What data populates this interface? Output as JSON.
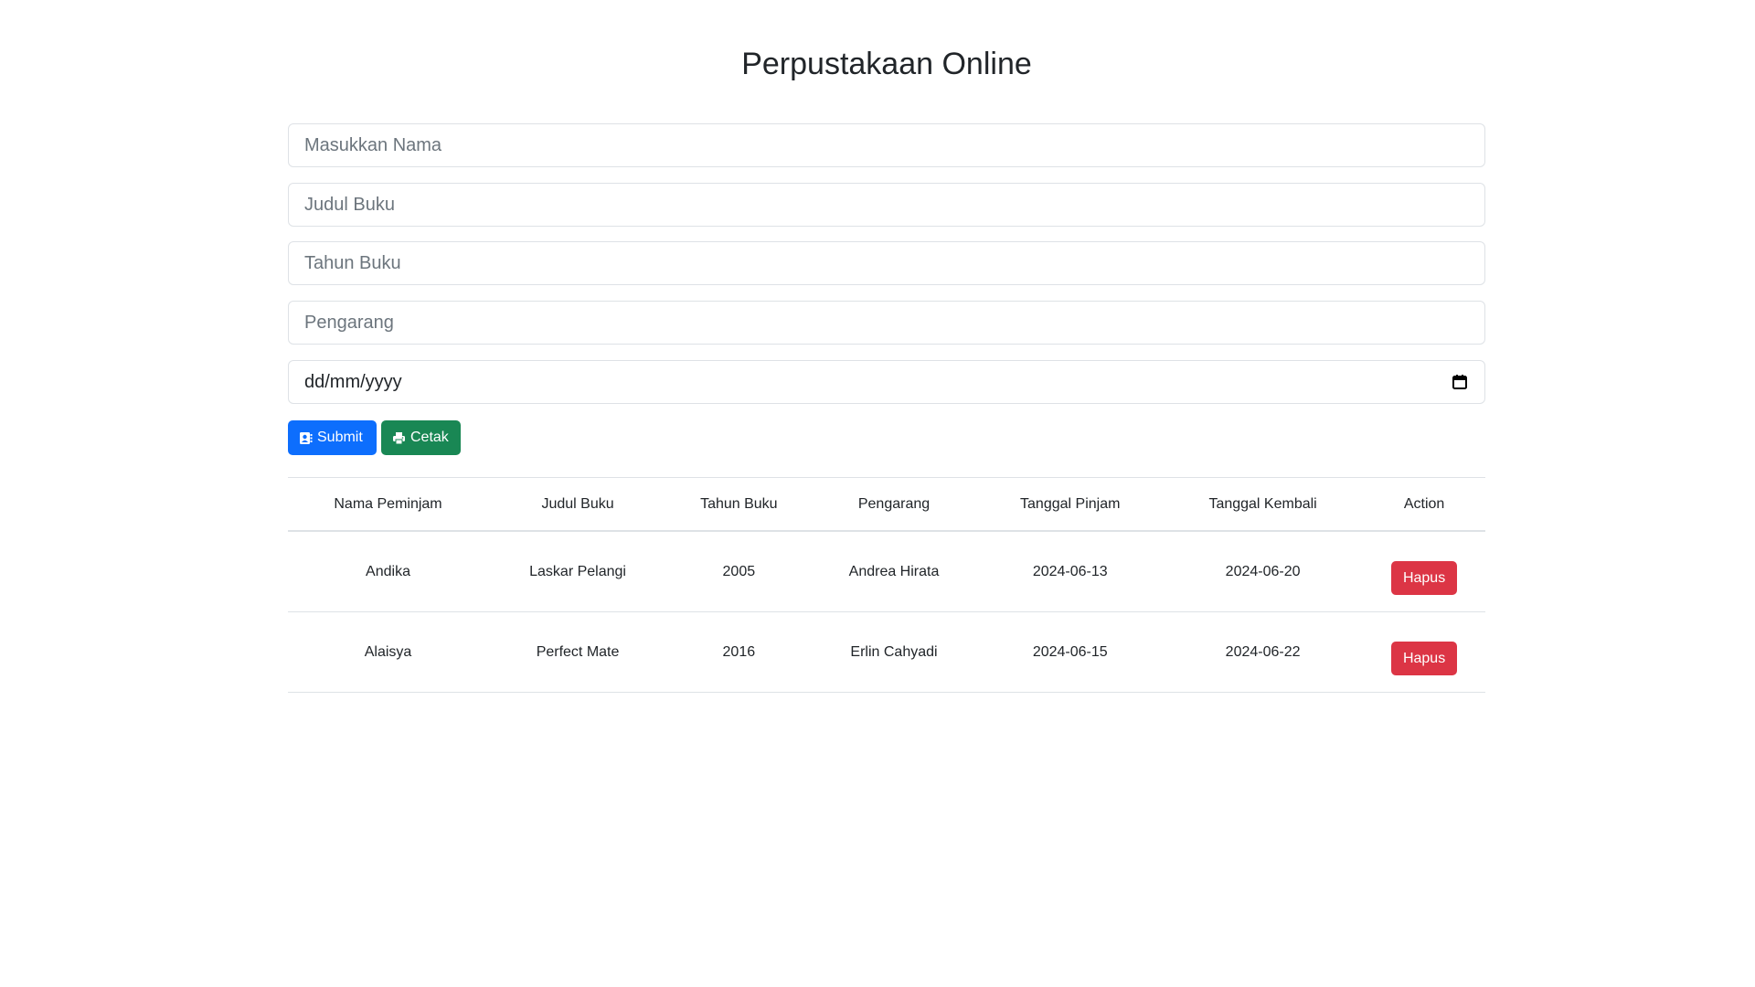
{
  "title": "Perpustakaan Online",
  "form": {
    "nama_placeholder": "Masukkan Nama",
    "judul_placeholder": "Judul Buku",
    "tahun_placeholder": "Tahun Buku",
    "pengarang_placeholder": "Pengarang",
    "date_placeholder": "dd/mm/yyyy",
    "date_icon": "calendar-icon"
  },
  "buttons": {
    "submit_label": "Submit",
    "submit_icon": "address-card-icon",
    "cetak_label": "Cetak",
    "cetak_icon": "printer-icon"
  },
  "colors": {
    "primary": "#0d6efd",
    "success": "#198754",
    "danger": "#dc3545"
  },
  "table": {
    "headers": [
      "Nama Peminjam",
      "Judul Buku",
      "Tahun Buku",
      "Pengarang",
      "Tanggal Pinjam",
      "Tanggal Kembali",
      "Action"
    ],
    "rows": [
      {
        "nama": "Andika",
        "judul": "Laskar Pelangi",
        "tahun": "2005",
        "pengarang": "Andrea Hirata",
        "tanggal_pinjam": "2024-06-13",
        "tanggal_kembali": "2024-06-20",
        "action_label": "Hapus"
      },
      {
        "nama": "Alaisya",
        "judul": "Perfect Mate",
        "tahun": "2016",
        "pengarang": "Erlin Cahyadi",
        "tanggal_pinjam": "2024-06-15",
        "tanggal_kembali": "2024-06-22",
        "action_label": "Hapus"
      }
    ]
  }
}
